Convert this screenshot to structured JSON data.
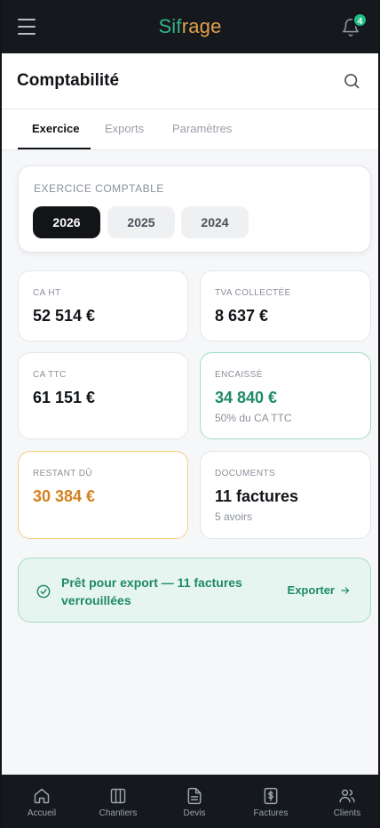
{
  "app": {
    "brand_part1": "Sif",
    "brand_part2": "rage",
    "notification_count": "4"
  },
  "header": {
    "title": "Comptabilité"
  },
  "tabs": [
    {
      "label": "Exercice",
      "active": true
    },
    {
      "label": "Exports",
      "active": false
    },
    {
      "label": "Paramètres",
      "active": false
    }
  ],
  "exercise": {
    "label": "EXERCICE COMPTABLE",
    "years": [
      {
        "label": "2026",
        "selected": true
      },
      {
        "label": "2025",
        "selected": false
      },
      {
        "label": "2024",
        "selected": false
      }
    ]
  },
  "stats": {
    "ca_ht": {
      "label": "CA HT",
      "value": "52 514 €"
    },
    "tva": {
      "label": "TVA COLLECTÉE",
      "value": "8 637 €"
    },
    "ca_ttc": {
      "label": "CA TTC",
      "value": "61 151 €"
    },
    "encaisse": {
      "label": "ENCAISSÉ",
      "value": "34 840 €",
      "sub": "50% du CA TTC"
    },
    "restant": {
      "label": "RESTANT DÛ",
      "value": "30 384 €"
    },
    "documents": {
      "label": "DOCUMENTS",
      "value": "11 factures",
      "sub": "5 avoirs"
    }
  },
  "banner": {
    "text": "Prêt pour export — 11 factures verrouillées",
    "action": "Exporter"
  },
  "bottom_nav": [
    {
      "label": "Accueil",
      "icon": "home-icon"
    },
    {
      "label": "Chantiers",
      "icon": "columns-icon"
    },
    {
      "label": "Devis",
      "icon": "document-icon"
    },
    {
      "label": "Factures",
      "icon": "invoice-icon"
    },
    {
      "label": "Clients",
      "icon": "users-icon"
    }
  ],
  "colors": {
    "accent_green": "#1e8a67",
    "accent_orange": "#d6801f",
    "dark": "#15181c"
  }
}
